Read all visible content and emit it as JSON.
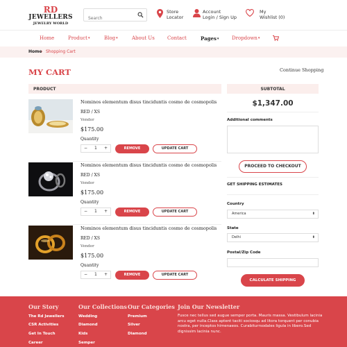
{
  "logo": {
    "line1": "RD",
    "line2": "JEWELLERS",
    "line3": "JEWELRY WORLD"
  },
  "search": {
    "placeholder": "Search",
    "icon": "search-icon"
  },
  "header": {
    "store_locator": {
      "line1": "Store",
      "line2": "Locator",
      "icon": "map-pin-icon"
    },
    "account": {
      "line1": "Account",
      "line2": "Login / Sign Up",
      "icon": "user-icon"
    },
    "wishlist": {
      "line1": "My",
      "line2": "Wishlist (0)",
      "icon": "heart-icon"
    }
  },
  "nav": {
    "home": "Home",
    "product": "Product",
    "blog": "Blog",
    "about": "About Us",
    "contact": "Contact",
    "pages": "Pages",
    "dropdown": "Dropdown",
    "cart_icon": "cart-icon",
    "caret": "▾"
  },
  "breadcrumb": {
    "home": "Home",
    "separator": "›",
    "current": "Shopping Cart"
  },
  "page": {
    "title": "MY CART",
    "continue": "Continue Shopping"
  },
  "cart": {
    "product_header": "PRODUCT",
    "items": [
      {
        "name": "Nominos elementum disus tinciduntis cosmo de cosmopolis",
        "variant": "RED / XS",
        "vendor": "Vendor",
        "price": "$175.00",
        "qty_label": "Quantity",
        "qty": "1",
        "minus": "−",
        "plus": "+",
        "remove": "REMOVE",
        "update": "UPDATE CART"
      },
      {
        "name": "Nominos elementum disus tinciduntis cosmo de cosmopolis",
        "variant": "RED / XS",
        "vendor": "Vendor",
        "price": "$175.00",
        "qty_label": "Quantity",
        "qty": "1",
        "minus": "−",
        "plus": "+",
        "remove": "REMOVE",
        "update": "UPDATE CART"
      },
      {
        "name": "Nominos elementum disus tinciduntis cosmo de cosmopolis",
        "variant": "RED / XS",
        "vendor": "Vendor",
        "price": "$175.00",
        "qty_label": "Quantity",
        "qty": "1",
        "minus": "−",
        "plus": "+",
        "remove": "REMOVE",
        "update": "UPDATE CART"
      }
    ]
  },
  "summary": {
    "subtotal_header": "SUBTOTAL",
    "total": "$1,347.00",
    "comments_label": "Additional comments",
    "checkout": "PROCEED TO CHECKOUT",
    "shipping_title": "GET SHIPPING ESTIMATES",
    "country_label": "Country",
    "country_value": "America",
    "state_label": "State",
    "state_value": "Delhi",
    "zip_label": "Postal/Zip Code",
    "calculate": "CALCULATE SHIPPING"
  },
  "footer": {
    "col1": {
      "title": "Our Story",
      "links": [
        "The Rd Jewellers",
        "CSR Activities",
        "Get In Touch",
        "Career"
      ]
    },
    "col2": {
      "title": "Our Collections",
      "links": [
        "Wedding",
        "Diamond",
        "Kids",
        "Semper"
      ]
    },
    "col3": {
      "title": "Our Categories",
      "links": [
        "Premium",
        "Silver",
        "Diamond"
      ]
    },
    "newsletter": {
      "title": "Join Our Newsletter",
      "text": "Fusce nec tellus sed augue semper porta. Mauris massa. Vestibulum lacinia arcu eget nulla.Class aptent taciti sociosqu ad litora torquent per conubia nostra, per inceptos himenaeos. Curabiturrsodales ligula in libero.Sed dignissim lacinia nunc."
    }
  },
  "colors": {
    "accent": "#d9454a",
    "light_pink": "#fbf1f0"
  }
}
